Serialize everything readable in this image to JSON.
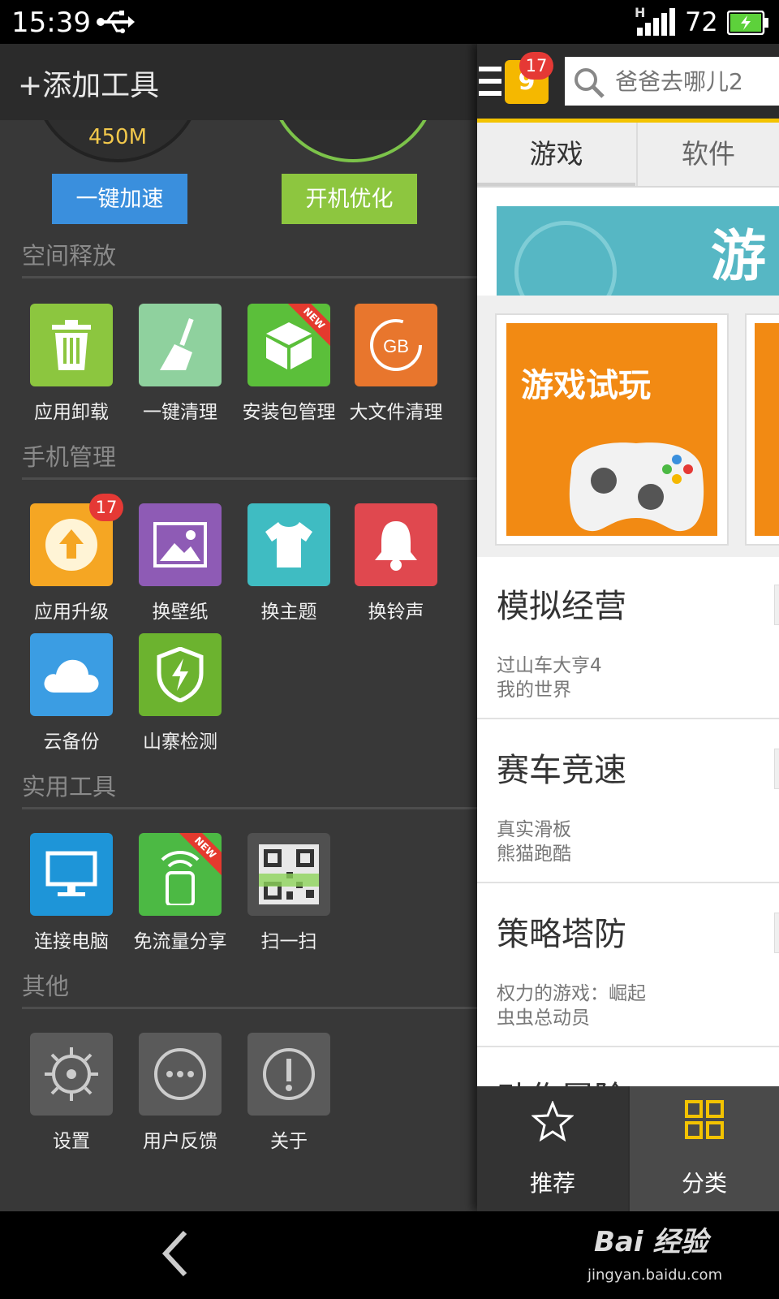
{
  "status_bar": {
    "time": "15:39",
    "network_type": "H",
    "battery_level": "72",
    "icons": [
      "usb-icon",
      "signal-icon",
      "battery-icon"
    ]
  },
  "drawer": {
    "add_tool_label": "+添加工具",
    "memory_readout": "450M",
    "boost_button": "一键加速",
    "boot_optimize_button": "开机优化",
    "sections": [
      {
        "title": "空间释放",
        "tools": [
          {
            "label": "应用卸载",
            "icon": "trash-icon",
            "color": "#8cc63f"
          },
          {
            "label": "一键清理",
            "icon": "broom-icon",
            "color": "#8fd19e"
          },
          {
            "label": "安装包管理",
            "icon": "box-icon",
            "color": "#5bbf3a",
            "ribbon": "NEW"
          },
          {
            "label": "大文件清理",
            "icon": "gb-icon",
            "color": "#e8762d"
          }
        ]
      },
      {
        "title": "手机管理",
        "tools": [
          {
            "label": "应用升级",
            "icon": "upgrade-arrow-icon",
            "color": "#f5a623",
            "badge": "17"
          },
          {
            "label": "换壁纸",
            "icon": "picture-icon",
            "color": "#8e5bb5"
          },
          {
            "label": "换主题",
            "icon": "tshirt-icon",
            "color": "#3fbcc2"
          },
          {
            "label": "换铃声",
            "icon": "bell-icon",
            "color": "#e0484f"
          },
          {
            "label": "云备份",
            "icon": "cloud-icon",
            "color": "#3b9de3"
          },
          {
            "label": "山寨检测",
            "icon": "shield-bolt-icon",
            "color": "#6cb32f"
          }
        ]
      },
      {
        "title": "实用工具",
        "tools": [
          {
            "label": "连接电脑",
            "icon": "monitor-icon",
            "color": "#1e95d8"
          },
          {
            "label": "免流量分享",
            "icon": "phone-wifi-icon",
            "color": "#4cb944",
            "ribbon": "NEW"
          },
          {
            "label": "扫一扫",
            "icon": "qr-code-icon",
            "color": "#505050"
          }
        ]
      },
      {
        "title": "其他",
        "tools": [
          {
            "label": "设置",
            "icon": "gear-icon",
            "color": "#5a5a5a"
          },
          {
            "label": "用户反馈",
            "icon": "chat-dots-icon",
            "color": "#5a5a5a"
          },
          {
            "label": "关于",
            "icon": "info-exclamation-icon",
            "color": "#5a5a5a"
          }
        ]
      }
    ]
  },
  "panel": {
    "logo_text": "9",
    "logo_badge": "17",
    "search_placeholder": "爸爸去哪儿2",
    "tabs": [
      {
        "label": "游戏",
        "active": true
      },
      {
        "label": "软件",
        "active": false
      }
    ],
    "banner_text": "游",
    "promo_title": "游戏试玩",
    "categories": [
      {
        "title": "模拟经营",
        "items": [
          "过山车大亨4",
          "我的世界"
        ]
      },
      {
        "title": "赛车竞速",
        "items": [
          "真实滑板",
          "熊猫跑酷"
        ]
      },
      {
        "title": "策略塔防",
        "items": [
          "权力的游戏：崛起",
          "虫虫总动员"
        ]
      },
      {
        "title": "动作冒险",
        "items": []
      }
    ],
    "bottom_nav": [
      {
        "label": "推荐",
        "icon": "star-icon"
      },
      {
        "label": "分类",
        "icon": "grid-icon",
        "active": true
      }
    ]
  },
  "watermark": {
    "logo": "Bai 经验",
    "url": "jingyan.baidu.com"
  },
  "colors": {
    "drawer_bg": "#383838",
    "accent_gold": "#f3c300",
    "boost_blue": "#3a8fdd",
    "boot_green": "#8dc63f"
  }
}
